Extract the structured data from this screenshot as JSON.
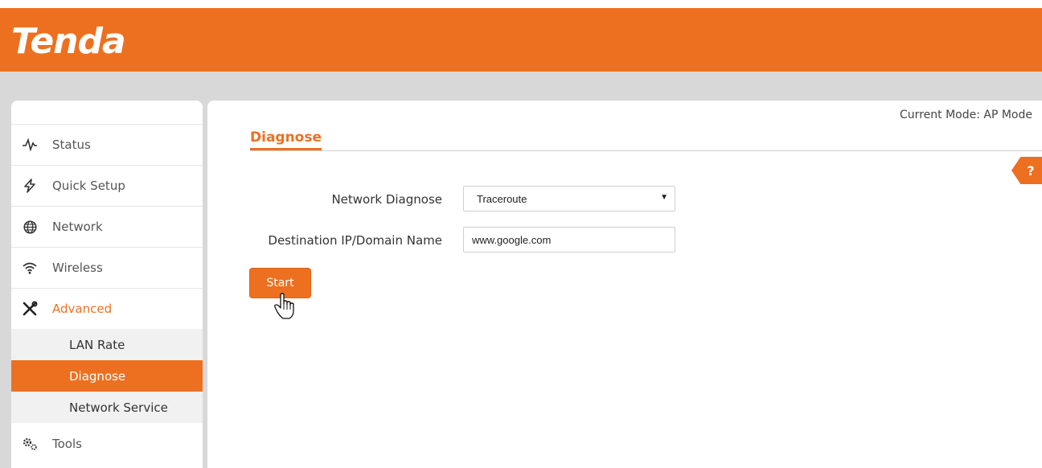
{
  "brand": {
    "logo_text": "Tenda",
    "accent_color": "#ed7020"
  },
  "header": {
    "mode_text": "Current Mode: AP Mode"
  },
  "sidebar": {
    "items": [
      {
        "label": "Status",
        "icon": "pulse-icon"
      },
      {
        "label": "Quick Setup",
        "icon": "lightning-icon"
      },
      {
        "label": "Network",
        "icon": "globe-icon"
      },
      {
        "label": "Wireless",
        "icon": "wifi-icon"
      },
      {
        "label": "Advanced",
        "icon": "tools-icon",
        "active": true
      },
      {
        "label": "Tools",
        "icon": "gears-icon"
      }
    ],
    "subitems": [
      {
        "label": "LAN Rate"
      },
      {
        "label": "Diagnose",
        "selected": true
      },
      {
        "label": "Network Service"
      }
    ]
  },
  "main": {
    "title": "Diagnose",
    "help_label": "?",
    "form": {
      "network_diagnose_label": "Network Diagnose",
      "network_diagnose_value": "Traceroute",
      "destination_label": "Destination IP/Domain Name",
      "destination_value": "www.google.com"
    },
    "start_label": "Start"
  }
}
